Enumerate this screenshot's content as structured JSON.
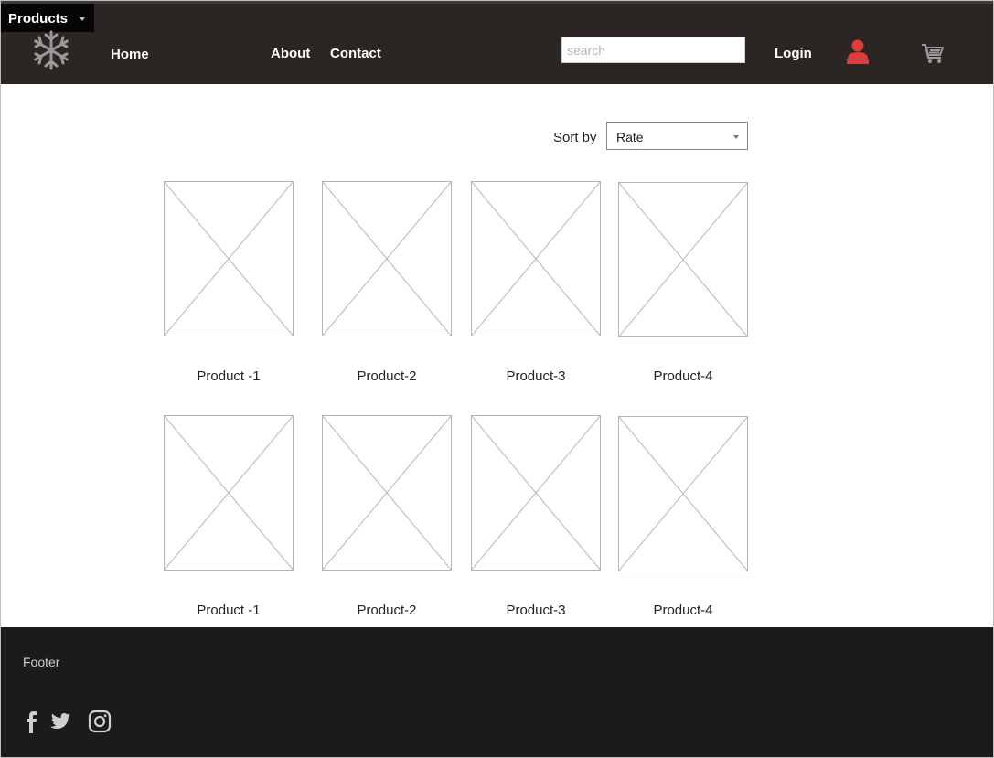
{
  "navbar": {
    "logo_icon": "snowflake-icon",
    "links": {
      "home": "Home",
      "products": "Products",
      "about": "About",
      "contact": "Contact"
    },
    "search_placeholder": "search",
    "login": "Login",
    "user_icon": "user-icon",
    "cart_icon": "cart-icon",
    "user_icon_color": "#e23b3b"
  },
  "sort": {
    "label": "Sort by",
    "selected": "Rate"
  },
  "products": {
    "row1": [
      "Product -1",
      "Product-2",
      "Product-3",
      "Product-4"
    ],
    "row2": [
      "Product -1",
      "Product-2",
      "Product-3",
      "Product-4"
    ]
  },
  "footer": {
    "label": "Footer",
    "social_icons": [
      "facebook-icon",
      "twitter-icon",
      "instagram-icon"
    ]
  }
}
